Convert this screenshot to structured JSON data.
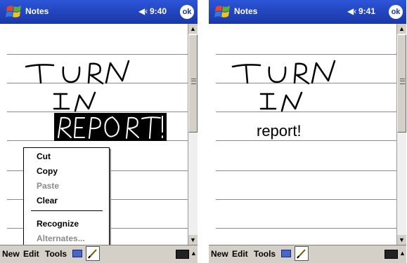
{
  "left_screen": {
    "app_title": "Notes",
    "clock": "9:40",
    "ok_label": "ok",
    "context_menu": {
      "items": [
        {
          "label": "Cut",
          "enabled": true
        },
        {
          "label": "Copy",
          "enabled": true
        },
        {
          "label": "Paste",
          "enabled": false
        },
        {
          "label": "Clear",
          "enabled": true
        },
        {
          "label": "Recognize",
          "enabled": true
        },
        {
          "label": "Alternates...",
          "enabled": false
        }
      ]
    }
  },
  "right_screen": {
    "app_title": "Notes",
    "clock": "9:41",
    "ok_label": "ok",
    "typed_text": "report!"
  },
  "menubar": {
    "new_label": "New",
    "edit_label": "Edit",
    "tools_label": "Tools"
  },
  "icons": {
    "start": "windows-flag-icon",
    "speaker": "speaker-icon",
    "recorder": "recorder-icon",
    "pen": "pen-icon",
    "keyboard": "keyboard-icon"
  },
  "colors": {
    "title_bar": "#1a37a6",
    "selection": "#000000"
  }
}
